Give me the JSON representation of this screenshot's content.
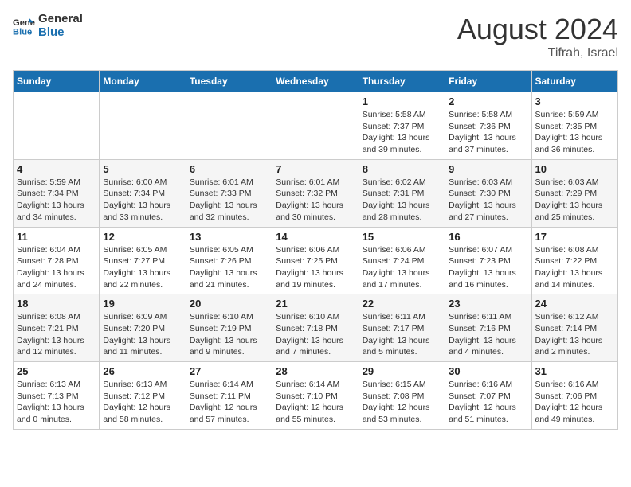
{
  "header": {
    "logo_line1": "General",
    "logo_line2": "Blue",
    "month_year": "August 2024",
    "location": "Tifrah, Israel"
  },
  "weekdays": [
    "Sunday",
    "Monday",
    "Tuesday",
    "Wednesday",
    "Thursday",
    "Friday",
    "Saturday"
  ],
  "weeks": [
    [
      {
        "day": "",
        "info": ""
      },
      {
        "day": "",
        "info": ""
      },
      {
        "day": "",
        "info": ""
      },
      {
        "day": "",
        "info": ""
      },
      {
        "day": "1",
        "info": "Sunrise: 5:58 AM\nSunset: 7:37 PM\nDaylight: 13 hours\nand 39 minutes."
      },
      {
        "day": "2",
        "info": "Sunrise: 5:58 AM\nSunset: 7:36 PM\nDaylight: 13 hours\nand 37 minutes."
      },
      {
        "day": "3",
        "info": "Sunrise: 5:59 AM\nSunset: 7:35 PM\nDaylight: 13 hours\nand 36 minutes."
      }
    ],
    [
      {
        "day": "4",
        "info": "Sunrise: 5:59 AM\nSunset: 7:34 PM\nDaylight: 13 hours\nand 34 minutes."
      },
      {
        "day": "5",
        "info": "Sunrise: 6:00 AM\nSunset: 7:34 PM\nDaylight: 13 hours\nand 33 minutes."
      },
      {
        "day": "6",
        "info": "Sunrise: 6:01 AM\nSunset: 7:33 PM\nDaylight: 13 hours\nand 32 minutes."
      },
      {
        "day": "7",
        "info": "Sunrise: 6:01 AM\nSunset: 7:32 PM\nDaylight: 13 hours\nand 30 minutes."
      },
      {
        "day": "8",
        "info": "Sunrise: 6:02 AM\nSunset: 7:31 PM\nDaylight: 13 hours\nand 28 minutes."
      },
      {
        "day": "9",
        "info": "Sunrise: 6:03 AM\nSunset: 7:30 PM\nDaylight: 13 hours\nand 27 minutes."
      },
      {
        "day": "10",
        "info": "Sunrise: 6:03 AM\nSunset: 7:29 PM\nDaylight: 13 hours\nand 25 minutes."
      }
    ],
    [
      {
        "day": "11",
        "info": "Sunrise: 6:04 AM\nSunset: 7:28 PM\nDaylight: 13 hours\nand 24 minutes."
      },
      {
        "day": "12",
        "info": "Sunrise: 6:05 AM\nSunset: 7:27 PM\nDaylight: 13 hours\nand 22 minutes."
      },
      {
        "day": "13",
        "info": "Sunrise: 6:05 AM\nSunset: 7:26 PM\nDaylight: 13 hours\nand 21 minutes."
      },
      {
        "day": "14",
        "info": "Sunrise: 6:06 AM\nSunset: 7:25 PM\nDaylight: 13 hours\nand 19 minutes."
      },
      {
        "day": "15",
        "info": "Sunrise: 6:06 AM\nSunset: 7:24 PM\nDaylight: 13 hours\nand 17 minutes."
      },
      {
        "day": "16",
        "info": "Sunrise: 6:07 AM\nSunset: 7:23 PM\nDaylight: 13 hours\nand 16 minutes."
      },
      {
        "day": "17",
        "info": "Sunrise: 6:08 AM\nSunset: 7:22 PM\nDaylight: 13 hours\nand 14 minutes."
      }
    ],
    [
      {
        "day": "18",
        "info": "Sunrise: 6:08 AM\nSunset: 7:21 PM\nDaylight: 13 hours\nand 12 minutes."
      },
      {
        "day": "19",
        "info": "Sunrise: 6:09 AM\nSunset: 7:20 PM\nDaylight: 13 hours\nand 11 minutes."
      },
      {
        "day": "20",
        "info": "Sunrise: 6:10 AM\nSunset: 7:19 PM\nDaylight: 13 hours\nand 9 minutes."
      },
      {
        "day": "21",
        "info": "Sunrise: 6:10 AM\nSunset: 7:18 PM\nDaylight: 13 hours\nand 7 minutes."
      },
      {
        "day": "22",
        "info": "Sunrise: 6:11 AM\nSunset: 7:17 PM\nDaylight: 13 hours\nand 5 minutes."
      },
      {
        "day": "23",
        "info": "Sunrise: 6:11 AM\nSunset: 7:16 PM\nDaylight: 13 hours\nand 4 minutes."
      },
      {
        "day": "24",
        "info": "Sunrise: 6:12 AM\nSunset: 7:14 PM\nDaylight: 13 hours\nand 2 minutes."
      }
    ],
    [
      {
        "day": "25",
        "info": "Sunrise: 6:13 AM\nSunset: 7:13 PM\nDaylight: 13 hours\nand 0 minutes."
      },
      {
        "day": "26",
        "info": "Sunrise: 6:13 AM\nSunset: 7:12 PM\nDaylight: 12 hours\nand 58 minutes."
      },
      {
        "day": "27",
        "info": "Sunrise: 6:14 AM\nSunset: 7:11 PM\nDaylight: 12 hours\nand 57 minutes."
      },
      {
        "day": "28",
        "info": "Sunrise: 6:14 AM\nSunset: 7:10 PM\nDaylight: 12 hours\nand 55 minutes."
      },
      {
        "day": "29",
        "info": "Sunrise: 6:15 AM\nSunset: 7:08 PM\nDaylight: 12 hours\nand 53 minutes."
      },
      {
        "day": "30",
        "info": "Sunrise: 6:16 AM\nSunset: 7:07 PM\nDaylight: 12 hours\nand 51 minutes."
      },
      {
        "day": "31",
        "info": "Sunrise: 6:16 AM\nSunset: 7:06 PM\nDaylight: 12 hours\nand 49 minutes."
      }
    ]
  ]
}
